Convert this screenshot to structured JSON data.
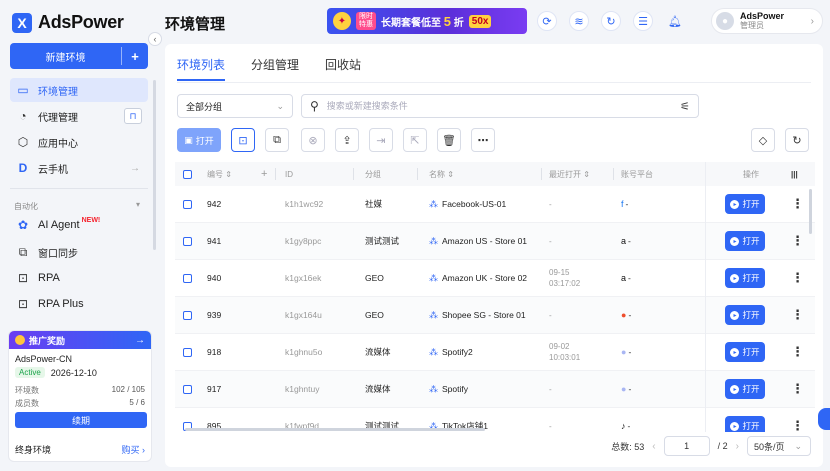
{
  "app": {
    "name": "AdsPower",
    "logo_letter": "X"
  },
  "sidebar": {
    "new_env_label": "新建环境",
    "new_env_plus": "+",
    "items": [
      {
        "label": "环境管理",
        "icon": "browser-window-icon",
        "glyph": "▭"
      },
      {
        "label": "代理管理",
        "icon": "proxy-icon",
        "glyph": "◔"
      },
      {
        "label": "应用中心",
        "icon": "app-center-icon",
        "glyph": "⬡"
      },
      {
        "label": "云手机",
        "icon": "cloud-phone-icon",
        "glyph": "D",
        "arrow": "→"
      }
    ],
    "section_label": "自动化",
    "section_chev": "▾",
    "auto_items": [
      {
        "label": "AI Agent",
        "icon": "ai-agent-icon",
        "glyph": "✿",
        "new": "NEW!"
      },
      {
        "label": "窗口同步",
        "icon": "window-sync-icon",
        "glyph": "⧉"
      },
      {
        "label": "RPA",
        "icon": "rpa-icon",
        "glyph": "⊡"
      },
      {
        "label": "RPA Plus",
        "icon": "rpa-plus-icon",
        "glyph": "⊡"
      }
    ],
    "promo": {
      "title": "推广奖励",
      "arrow": "→",
      "org": "AdsPower-CN",
      "status": "Active",
      "expiry": "2026-12-10",
      "env_label": "环境数",
      "env_value": "102 / 105",
      "member_label": "成员数",
      "member_value": "5 / 6",
      "renew": "续期",
      "lifetime": "终身环境",
      "buy": "购买 ›"
    }
  },
  "topbar": {
    "title": "环境管理",
    "banner": {
      "gift": "✦",
      "tag_line1": "限时",
      "tag_line2": "特惠",
      "text_a": "长期套餐低至",
      "text_big": "5",
      "text_b": "折",
      "badge": "50x"
    },
    "user": {
      "name": "AdsPower",
      "role": "管理员",
      "chev": "›",
      "avatar": "●"
    }
  },
  "main": {
    "tabs": [
      "环境列表",
      "分组管理",
      "回收站"
    ],
    "group_select": "全部分组",
    "search_placeholder": "搜索或新建搜索条件",
    "open_label": "打开",
    "columns": {
      "id_num": "编号 ⇕",
      "add": "+",
      "id": "ID",
      "group": "分组",
      "name": "名称 ⇕",
      "last_open": "最近打开 ⇕",
      "platform": "账号平台",
      "actions": "操作",
      "cols_icon": "|||"
    },
    "rows": [
      {
        "num": "942",
        "id": "k1h1wc92",
        "group": "社媒",
        "name": "Facebook-US-01",
        "opened_1": "-",
        "opened_2": "",
        "plat_glyph": "f",
        "plat_color": "#1877f2",
        "plat_text": "-"
      },
      {
        "num": "941",
        "id": "k1gy8ppc",
        "group": "测试测试",
        "name": "Amazon US - Store 01",
        "opened_1": "-",
        "opened_2": "",
        "plat_glyph": "a",
        "plat_color": "#111111",
        "plat_text": "-"
      },
      {
        "num": "940",
        "id": "k1gx16ek",
        "group": "GEO",
        "name": "Amazon UK - Store 02",
        "opened_1": "09-15",
        "opened_2": "03:17:02",
        "plat_glyph": "a",
        "plat_color": "#111111",
        "plat_text": "-"
      },
      {
        "num": "939",
        "id": "k1gx164u",
        "group": "GEO",
        "name": "Shopee SG - Store 01",
        "opened_1": "-",
        "opened_2": "",
        "plat_glyph": "●",
        "plat_color": "#ee4d2d",
        "plat_text": "-"
      },
      {
        "num": "918",
        "id": "k1ghnu5o",
        "group": "流媒体",
        "name": "Spotify2",
        "opened_1": "09-02",
        "opened_2": "10:03:01",
        "plat_glyph": "●",
        "plat_color": "#a9b6f3",
        "plat_text": "-"
      },
      {
        "num": "917",
        "id": "k1ghntuy",
        "group": "流媒体",
        "name": "Spotify",
        "opened_1": "-",
        "opened_2": "",
        "plat_glyph": "●",
        "plat_color": "#a9b6f3",
        "plat_text": "-"
      },
      {
        "num": "895",
        "id": "k1fwpf9d",
        "group": "测试测试",
        "name": "TikTok店铺1",
        "opened_1": "-",
        "opened_2": "",
        "plat_glyph": "♪",
        "plat_color": "#111111",
        "plat_text": "-"
      }
    ],
    "pager": {
      "total": "总数: 53",
      "prev": "‹",
      "page": "1",
      "of": "/ 2",
      "next": "›",
      "per_page": "50条/页",
      "chev": "⌄"
    }
  },
  "colors": {
    "accent": "#2f66f5",
    "active_green": "#1aa34a",
    "new_red": "#f5222d"
  }
}
